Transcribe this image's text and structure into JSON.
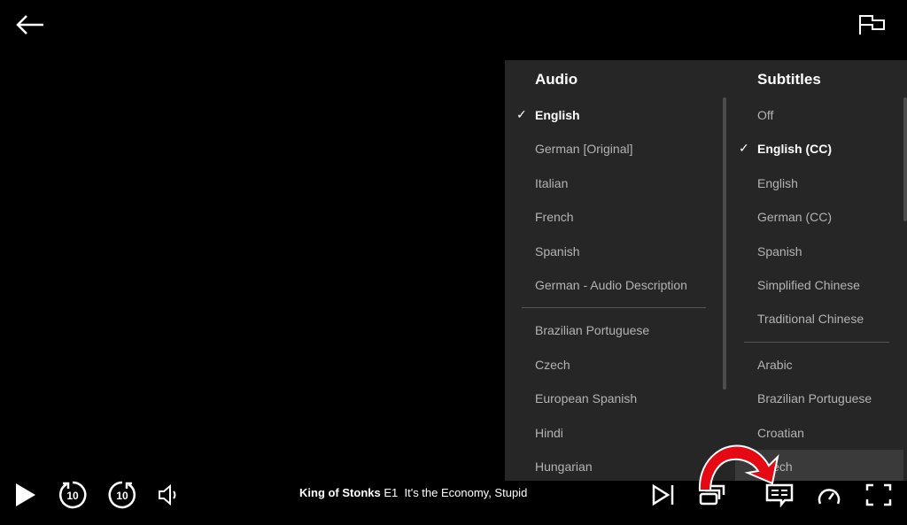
{
  "top": {
    "back_icon": "arrow-left-icon",
    "report_icon": "flag-icon"
  },
  "audio": {
    "heading": "Audio",
    "selected": "English",
    "items": [
      "English",
      "German [Original]",
      "Italian",
      "French",
      "Spanish",
      "German - Audio Description"
    ],
    "more_items": [
      "Brazilian Portuguese",
      "Czech",
      "European Spanish",
      "Hindi",
      "Hungarian"
    ]
  },
  "subtitles": {
    "heading": "Subtitles",
    "selected": "English (CC)",
    "items": [
      "Off",
      "English (CC)",
      "English",
      "German (CC)",
      "Spanish",
      "Simplified Chinese",
      "Traditional Chinese"
    ],
    "more_items": [
      "Arabic",
      "Brazilian Portuguese",
      "Croatian",
      "Czech"
    ]
  },
  "player": {
    "show": "King of Stonks",
    "episode": "E1",
    "episode_title": "It's the Economy, Stupid",
    "rewind_seconds": "10",
    "forward_seconds": "10"
  },
  "annotation": {
    "arrow_color": "#e50914"
  }
}
